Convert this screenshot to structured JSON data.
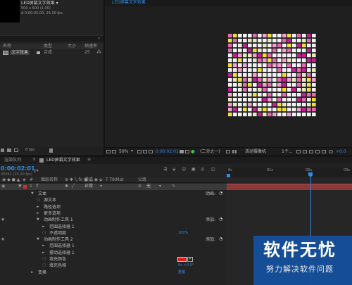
{
  "project": {
    "comp_name": "LED屏幕文字效果 ▾",
    "comp_size": "500 x 500 (1.00)",
    "comp_duration": "Δ 0:00:05:00, 25.00 fps",
    "columns": {
      "name": "名称",
      "type": "类型",
      "size": "大小",
      "framerate": "帧速率"
    },
    "item": {
      "name": "文字效果",
      "type": "合成",
      "size": "",
      "framerate": "25"
    },
    "bpc": "8 bpc"
  },
  "viewer": {
    "tab": "LED屏幕文字效果",
    "zoom": "50%",
    "timecode": "0:00:02:01",
    "resolution": "(二分之一)",
    "view_mode": "活动摄像机",
    "views": "1个...",
    "exposure": "+0.0"
  },
  "timeline": {
    "tabs": [
      {
        "label": "渲染队列"
      },
      {
        "label": "LED屏幕文字效果"
      }
    ],
    "timecode": "0:00:02:01",
    "frame_info": "00051 (25.00 fps)",
    "search_placeholder": "ρ▾",
    "col_source": "图层名称",
    "col_mode": "模式",
    "col_trkmat": "T TrkMat",
    "col_parent": "父级",
    "ruler": [
      "0s",
      "01s",
      "02s",
      "03s"
    ],
    "layer": {
      "number": "1",
      "type": "T",
      "mode": "正常",
      "parent": "无"
    },
    "properties": [
      {
        "label": "文本",
        "level": 1,
        "twirl": "▼",
        "extra": "动画:",
        "extra_type": "label"
      },
      {
        "label": "源文本",
        "level": 2,
        "twirl": "",
        "extra": "",
        "extra_type": ""
      },
      {
        "label": "路径选项",
        "level": 2,
        "twirl": "►",
        "extra": "",
        "extra_type": ""
      },
      {
        "label": "更多选项",
        "level": 2,
        "twirl": "►",
        "extra": "",
        "extra_type": ""
      },
      {
        "label": "动画制作工具 1",
        "level": 2,
        "twirl": "▼",
        "extra": "添加:",
        "extra_type": "label"
      },
      {
        "label": "范围选择器 1",
        "level": 3,
        "twirl": "►",
        "extra": "",
        "extra_type": ""
      },
      {
        "label": "不透明度",
        "level": 3,
        "twirl": "",
        "extra": "100%",
        "extra_type": "value"
      },
      {
        "label": "动画制作工具 2",
        "level": 2,
        "twirl": "▼",
        "extra": "添加:",
        "extra_type": "label"
      },
      {
        "label": "范围选择器 1",
        "level": 3,
        "twirl": "►",
        "extra": "",
        "extra_type": ""
      },
      {
        "label": "摆动选择器 1",
        "level": 3,
        "twirl": "►",
        "extra": "",
        "extra_type": ""
      },
      {
        "label": "填充颜色",
        "level": 3,
        "twirl": "",
        "extra": "",
        "extra_type": "swatch"
      },
      {
        "label": "填充色相",
        "level": 3,
        "twirl": "",
        "extra": "0x +0.0°",
        "extra_type": "value"
      },
      {
        "label": "变换",
        "level": 1,
        "twirl": "►",
        "extra": "重置",
        "extra_type": "value"
      }
    ]
  },
  "watermark": {
    "title": "软件无忧",
    "subtitle": "努力解决软件问题"
  },
  "colors": {
    "accent_blue": "#2d8ceb",
    "layer_red": "#c83232",
    "swatch_red": "#e41b1b",
    "led_white": "#f4f2f5",
    "led_pink": "#e46ab1",
    "led_yellow": "#f0e03c",
    "led_magenta": "#c81e96"
  }
}
